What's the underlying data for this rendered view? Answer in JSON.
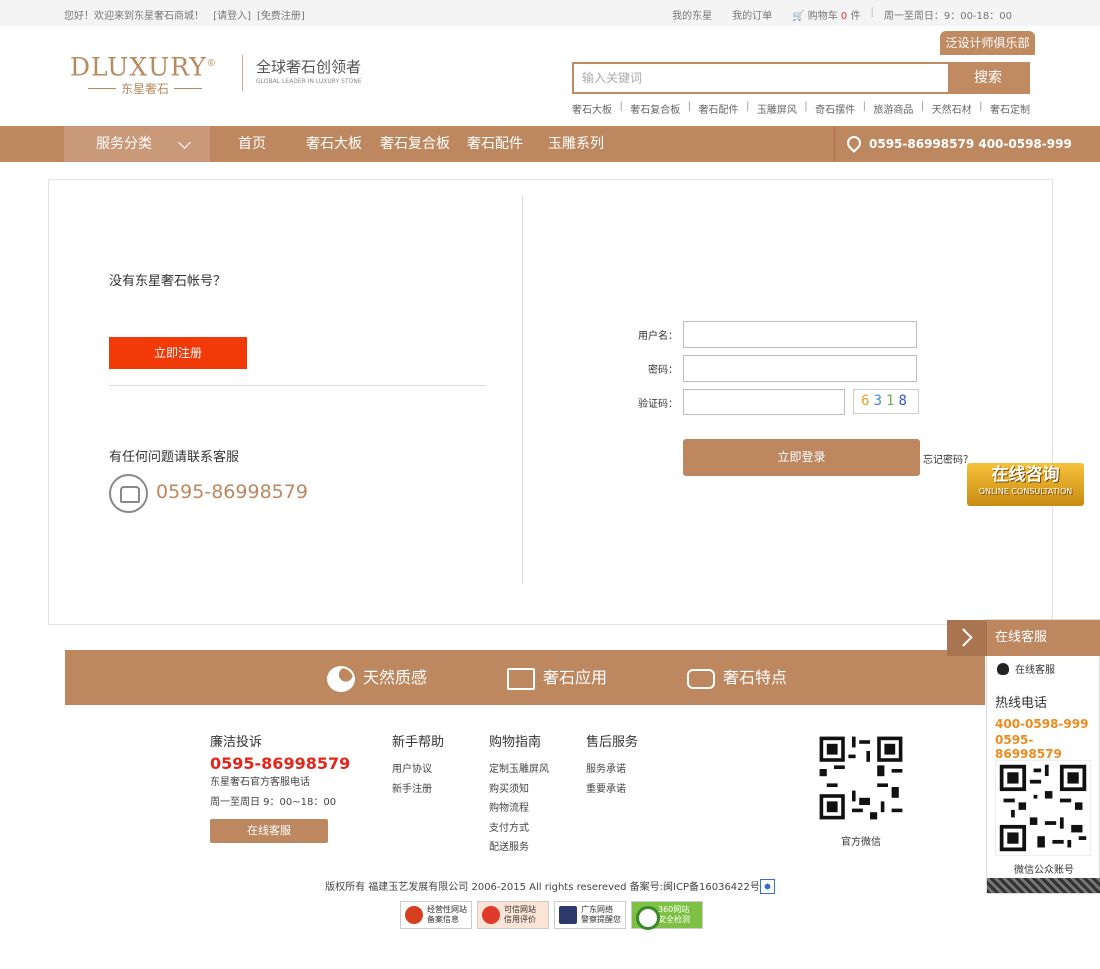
{
  "topbar": {
    "welcome": "您好！欢迎来到东星奢石商城！",
    "login": "[请登入]",
    "register": "[免费注册]",
    "my_store": "我的东星",
    "my_orders": "我的订单",
    "cart_label": "购物车",
    "cart_count": "0",
    "cart_unit": "件",
    "hours": "周一至周日：9：00-18：00"
  },
  "header": {
    "logo_en": "DLUXURY",
    "logo_reg": "®",
    "logo_cn": "东星奢石",
    "slogan_cn": "全球奢石创领者",
    "slogan_en": "GLOBAL LEADER IN LUXURY STONE",
    "club_button": "泛设计师俱乐部",
    "search_placeholder": "输入关键词",
    "search_button": "搜索",
    "hot_words": [
      "奢石大板",
      "奢石复合板",
      "奢石配件",
      "玉雕屏风",
      "奇石摆件",
      "旅游商品",
      "天然石材",
      "奢石定制"
    ]
  },
  "nav": {
    "category": "服务分类",
    "items": [
      "首页",
      "奢石大板",
      "奢石复合板",
      "奢石配件",
      "玉雕系列"
    ],
    "phone": "0595-86998579  400-0598-999"
  },
  "register_panel": {
    "question": "没有东星奢石帐号？",
    "register_button": "立即注册",
    "help_text": "有任何问题请联系客服",
    "phone": "0595-86998579"
  },
  "login_form": {
    "username_label": "用户名：",
    "password_label": "密码：",
    "captcha_label": "验证码：",
    "captcha_digits": [
      "6",
      "3",
      "1",
      "8"
    ],
    "login_button": "立即登录",
    "forgot": "忘记密码？"
  },
  "consult_badge": {
    "cn": "在线咨询",
    "en": "ONLINE CONSULTATION"
  },
  "features": [
    "天然质感",
    "奢石应用",
    "奢石特点"
  ],
  "service_panel": {
    "title": "在线客服",
    "qq_service": "在线客服",
    "hotline_label": "热线电话",
    "phone1": "400-0598-999",
    "phone2": "0595-86998579",
    "wechat_label": "微信公众账号"
  },
  "footer": {
    "complaint_title": "廉洁投诉",
    "complaint_phone": "0595-86998579",
    "complaint_desc": "东星奢石官方客服电话",
    "complaint_hours": "周一至周日 9：00~18：00",
    "online_service_button": "在线客服",
    "columns": [
      {
        "title": "新手帮助",
        "links": [
          "用户协议",
          "新手注册"
        ]
      },
      {
        "title": "购物指南",
        "links": [
          "定制玉雕屏风",
          "购买须知",
          "购物流程",
          "支付方式",
          "配送服务"
        ]
      },
      {
        "title": "售后服务",
        "links": [
          "服务承诺",
          "重要承诺"
        ]
      }
    ],
    "qr_label": "官方微信",
    "copyright": "版权所有 福建玉艺发展有限公司 2006-2015 All rights resereved 备案号:闽ICP备16036422号",
    "badges": [
      {
        "line1": "经营性网站",
        "line2": "备案信息"
      },
      {
        "line1": "可信网站",
        "line2": "信用评价"
      },
      {
        "line1": "广东网络",
        "line2": "警察提醒您"
      },
      {
        "line1": "360网站",
        "line2": "安全检测"
      }
    ]
  },
  "colors": {
    "brand": "#bd8860",
    "register_red": "#f23a08",
    "hotline_orange": "#f08a1c",
    "footer_phone_red": "#e5251b"
  }
}
